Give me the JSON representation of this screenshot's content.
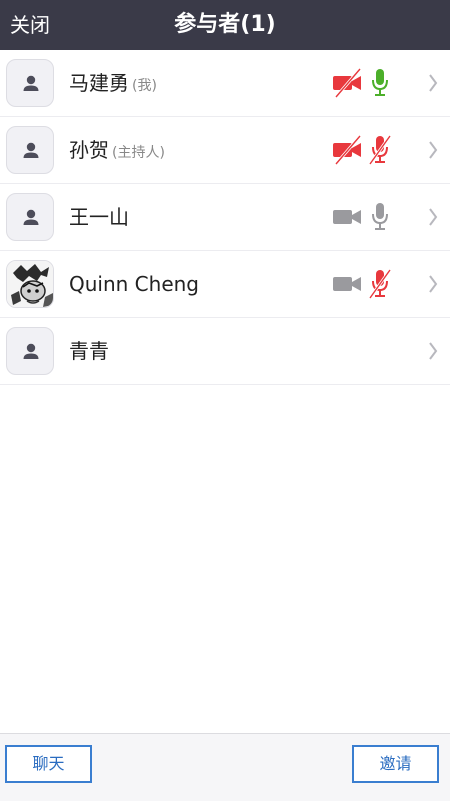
{
  "header": {
    "close_label": "关闭",
    "title": "参与者(1)"
  },
  "participants": [
    {
      "name": "马建勇",
      "tag": "(我)",
      "avatar": "default-avatar",
      "video": "off",
      "audio": "on"
    },
    {
      "name": "孙贺",
      "tag": "(主持人)",
      "avatar": "default-avatar",
      "video": "off",
      "audio": "muted"
    },
    {
      "name": "王一山",
      "tag": "",
      "avatar": "default-avatar",
      "video": "available",
      "audio": "available"
    },
    {
      "name": "Quinn Cheng",
      "tag": "",
      "avatar": "photo-avatar",
      "video": "available",
      "audio": "muted"
    },
    {
      "name": "青青",
      "tag": "",
      "avatar": "default-avatar",
      "video": "none",
      "audio": "none"
    }
  ],
  "footer": {
    "chat_label": "聊天",
    "invite_label": "邀请"
  },
  "colors": {
    "header_bg": "#3a3a48",
    "off_red": "#e8383d",
    "on_green": "#4caf2a",
    "neutral_gray": "#9a9a9e",
    "button_blue": "#3a7ed0"
  }
}
